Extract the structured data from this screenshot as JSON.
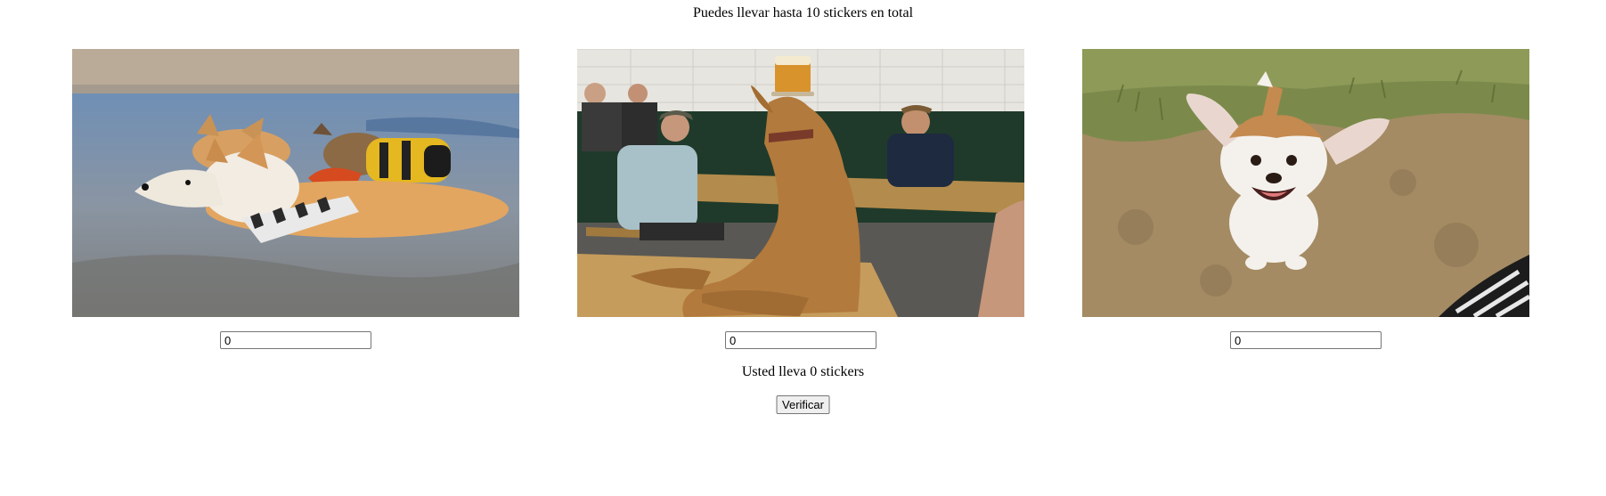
{
  "header": {
    "limit_text": "Puedes llevar hasta 10 stickers en total"
  },
  "stickers": [
    {
      "image": "corgis-swimming-photo",
      "quantity": "0"
    },
    {
      "image": "golden-retriever-beer-photo",
      "quantity": "0"
    },
    {
      "image": "happy-puppy-dirt-photo",
      "quantity": "0"
    }
  ],
  "summary": {
    "count_text": "Usted lleva 0 stickers"
  },
  "actions": {
    "verify_label": "Verificar"
  }
}
